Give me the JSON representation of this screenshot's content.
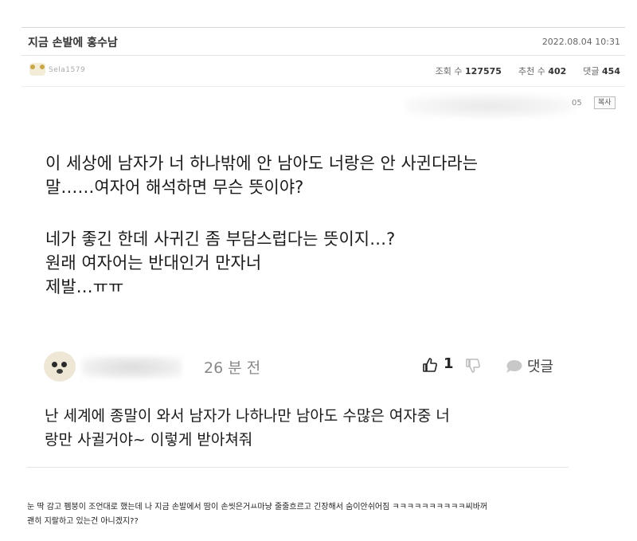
{
  "post": {
    "title": "지금 손발에 홍수남",
    "date": "2022.08.04 10:31",
    "author_nick": "Sela1579",
    "stats": {
      "views_label": "조회 수",
      "views": "127575",
      "recommend_label": "추천 수",
      "recommend": "402",
      "comments_label": "댓글",
      "comments": "454"
    },
    "link_suffix": "05",
    "copy_label": "복사"
  },
  "screenshot": {
    "question": [
      "이 세상에 남자가 너 하나밖에 안 남아도 너랑은 안 사귄다라는",
      "말……여자어 해석하면 무슨 뜻이야?"
    ],
    "followup": [
      "네가 좋긴 한데 사귀긴 좀 부담스럽다는 뜻이지…?",
      "원래 여자어는 반대인거 만자너",
      "제발…ㅠㅠ"
    ],
    "comment": {
      "time": "26 분 전",
      "likes": "1",
      "reply_label": "댓글",
      "text": [
        "난 세계에 종말이 와서 남자가 나하나만 남아도 수많은 여자중 너",
        "랑만 사귈거야~ 이렇게 받아쳐줘"
      ]
    }
  },
  "caption": [
    "눈 딱 감고 펨붕이 조언대로 했는데 나 지금 손발에서 땀이 손씻은거ㅛ마냥 줄줄흐르고 긴장해서 숨이안쉬어짐 ㅋㅋㅋㅋㅋㅋㅋㅋㅋㅋ씨바꺼",
    "괜히 지랄하고 있는건 아니겠지??"
  ],
  "colors": {
    "accent": "#333333",
    "muted": "#888888",
    "divider": "#e4e4e4"
  },
  "icons": [
    "author-avatar-icon",
    "thumbs-up-icon",
    "thumbs-down-icon",
    "speech-bubble-icon"
  ]
}
